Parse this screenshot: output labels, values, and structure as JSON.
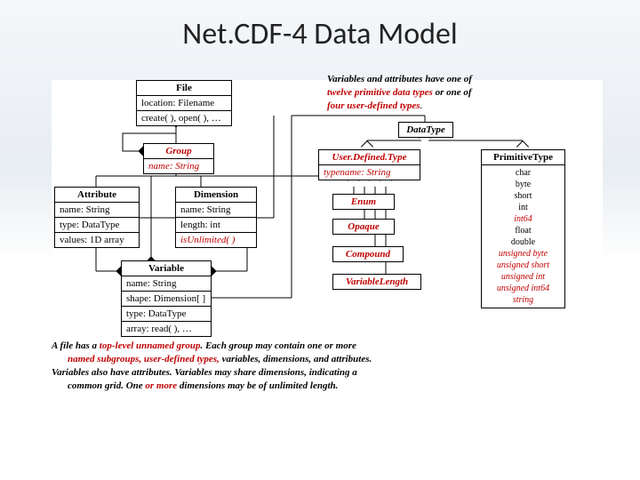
{
  "title": "Net.CDF-4 Data Model",
  "topCaption": {
    "line1a": "Variables and attributes have one of",
    "line2a": "twelve primitive data types",
    "line2b": " or one of",
    "line3a": "four user-defined types",
    "line3b": "."
  },
  "boxes": {
    "file": {
      "header": "File",
      "row1": "location: Filename",
      "row2": "create( ), open( ), …"
    },
    "group": {
      "header": "Group",
      "row1": "name: String"
    },
    "attribute": {
      "header": "Attribute",
      "row1": "name: String",
      "row2": "type: DataType",
      "row3": "values: 1D array"
    },
    "dimension": {
      "header": "Dimension",
      "row1": "name: String",
      "row2": "length: int",
      "row3": "isUnlimited( )"
    },
    "variable": {
      "header": "Variable",
      "row1": "name: String",
      "row2": "shape: Dimension[ ]",
      "row3": "type:  DataType",
      "row4": "array: read( ), …"
    },
    "dataType": {
      "header": "DataType"
    },
    "userDefinedType": {
      "header": "User.Defined.Type",
      "row1": "typename: String"
    },
    "primitiveType": {
      "header": "PrimitiveType",
      "r1": "char",
      "r2": "byte",
      "r3": "short",
      "r4": "int",
      "r5": "int64",
      "r6": "float",
      "r7": "double",
      "r8": "unsigned byte",
      "r9": "unsigned short",
      "r10": "unsigned int",
      "r11": "unsigned int64",
      "r12": "string"
    },
    "enum": {
      "header": "Enum"
    },
    "opaque": {
      "header": "Opaque"
    },
    "compound": {
      "header": "Compound"
    },
    "variableLength": {
      "header": "VariableLength"
    }
  },
  "bottomCaption": {
    "l1a": "A file has a ",
    "l1b": "top-level unnamed group",
    "l1c": ".  Each group may contain one or more",
    "l2a": "named subgroups, user-defined types,",
    "l2b": " variables, dimensions, and attributes.",
    "l3": "Variables also have attributes. Variables may share dimensions, indicating a",
    "l4a": "common grid.  One ",
    "l4b": "or more",
    "l4c": " dimensions may be of unlimited length."
  }
}
